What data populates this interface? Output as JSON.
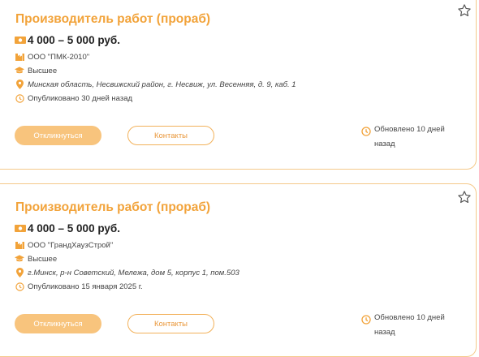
{
  "accent_color": "#f2a33a",
  "vacancies": [
    {
      "title": "Производитель работ (прораб)",
      "salary": "4 000 – 5 000 руб.",
      "company": "ООО \"ПМК-2010\"",
      "education": "Высшее",
      "address": "Минская область, Несвижский район, г. Несвиж, ул. Весенняя, д. 9, каб. 1",
      "published": "Опубликовано 30 дней назад",
      "respond_label": "Откликнуться",
      "contacts_label": "Контакты",
      "updated": "Обновлено 10 дней назад"
    },
    {
      "title": "Производитель работ (прораб)",
      "salary": "4 000 – 5 000 руб.",
      "company": "ООО \"ГрандХаузСтрой\"",
      "education": "Высшее",
      "address": "г.Минск, р-н Советский, Мележа, дом 5, корпус 1, пом.503",
      "published": "Опубликовано 15 января 2025 г.",
      "respond_label": "Откликнуться",
      "contacts_label": "Контакты",
      "updated": "Обновлено 10 дней назад"
    }
  ],
  "icons": {
    "favorite": "star-icon",
    "salary": "money-icon",
    "company": "building-icon",
    "education": "graduation-cap-icon",
    "address": "location-pin-icon",
    "published": "clock-icon",
    "updated": "clock-icon"
  }
}
